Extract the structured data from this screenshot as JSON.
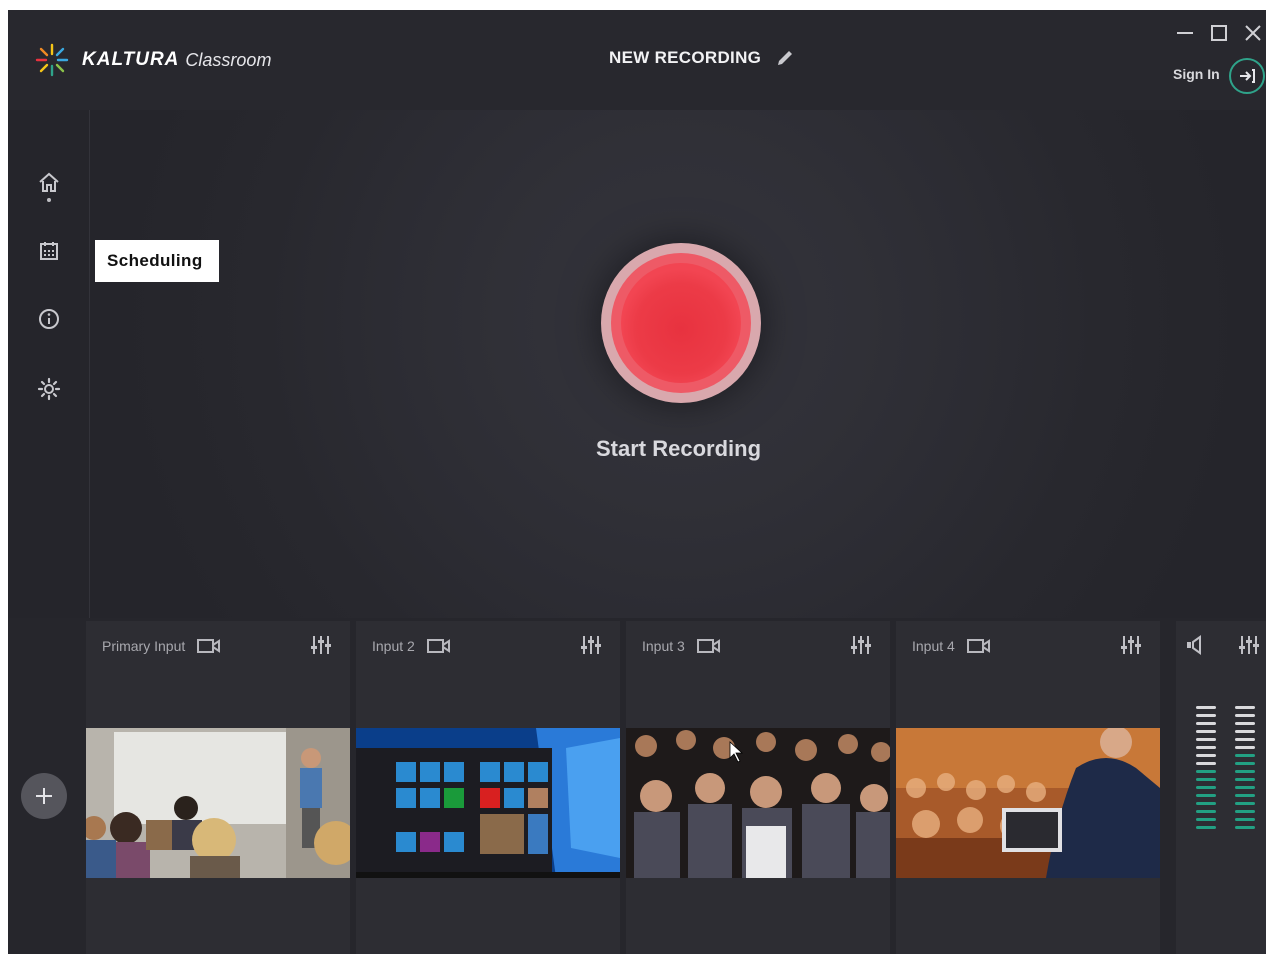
{
  "app": {
    "brand": "KALTURA",
    "product": "Classroom",
    "recording_title": "NEW RECORDING",
    "sign_in": "Sign In"
  },
  "sidebar": {
    "items": [
      {
        "icon": "home-icon",
        "label": "Home"
      },
      {
        "icon": "calendar-icon",
        "label": "Scheduling"
      },
      {
        "icon": "info-icon",
        "label": "Info"
      },
      {
        "icon": "gear-icon",
        "label": "Settings"
      }
    ],
    "tooltip": "Scheduling"
  },
  "stage": {
    "start_label": "Start Recording"
  },
  "inputs": [
    {
      "label": "Primary Input",
      "preview": "classroom-presentation"
    },
    {
      "label": "Input 2",
      "preview": "windows-desktop"
    },
    {
      "label": "Input 3",
      "preview": "audience"
    },
    {
      "label": "Input 4",
      "preview": "conference-speaker"
    }
  ],
  "audio": {
    "meter_levels": [
      0.5,
      0.6
    ]
  },
  "colors": {
    "accent": "#2fa38a",
    "record": "#e8323f",
    "meter_active": "#22a083",
    "meter_idle": "#d9d9dc"
  }
}
